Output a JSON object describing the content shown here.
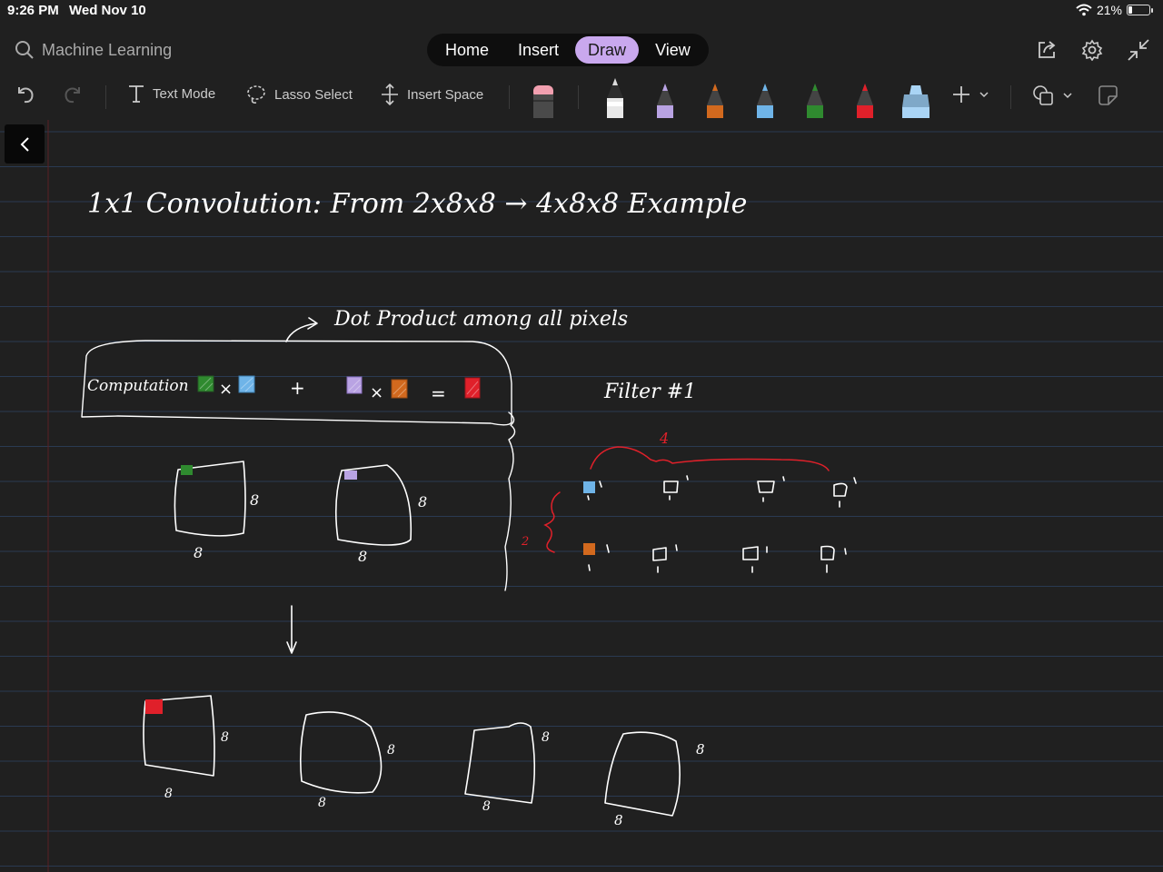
{
  "status": {
    "time": "9:26 PM",
    "date": "Wed Nov 10",
    "battery": "21%",
    "battery_level": 0.21
  },
  "search": {
    "label": "Machine Learning"
  },
  "tabs": [
    {
      "label": "Home"
    },
    {
      "label": "Insert"
    },
    {
      "label": "Draw",
      "active": true
    },
    {
      "label": "View"
    }
  ],
  "toolbar": {
    "text_mode": "Text Mode",
    "lasso_select": "Lasso Select",
    "insert_space": "Insert Space"
  },
  "pens": [
    {
      "name": "white-pen",
      "color": "#e8e8e8"
    },
    {
      "name": "lavender-pen",
      "color": "#b9a3e3"
    },
    {
      "name": "orange-pen",
      "color": "#d2691e"
    },
    {
      "name": "blue-pen",
      "color": "#6fb4e8"
    },
    {
      "name": "green-pen",
      "color": "#2f8a2f"
    },
    {
      "name": "red-pen",
      "color": "#e0202a"
    },
    {
      "name": "highlighter",
      "color": "#a9d4f5"
    }
  ],
  "colors": {
    "canvas_bg": "#202020",
    "ruled_line": "#2a3a52",
    "margin_line": "#5a1f24",
    "ink": "#ffffff",
    "accent_tab": "#c9a8ee",
    "red_ink": "#e0202a",
    "green_swatch": "#2f8a2f",
    "blue_swatch": "#6fb4e8",
    "purple_swatch": "#b9a3e3",
    "orange_swatch": "#d2691e"
  },
  "notes": {
    "title": "1x1 Convolution: From 2x8x8 → 4x8x8 Example",
    "dot_product": "Dot Product among all pixels",
    "computation": "Computation",
    "filter": "Filter #1",
    "num_filters": "4",
    "num_channels": "2",
    "size8": "8"
  }
}
